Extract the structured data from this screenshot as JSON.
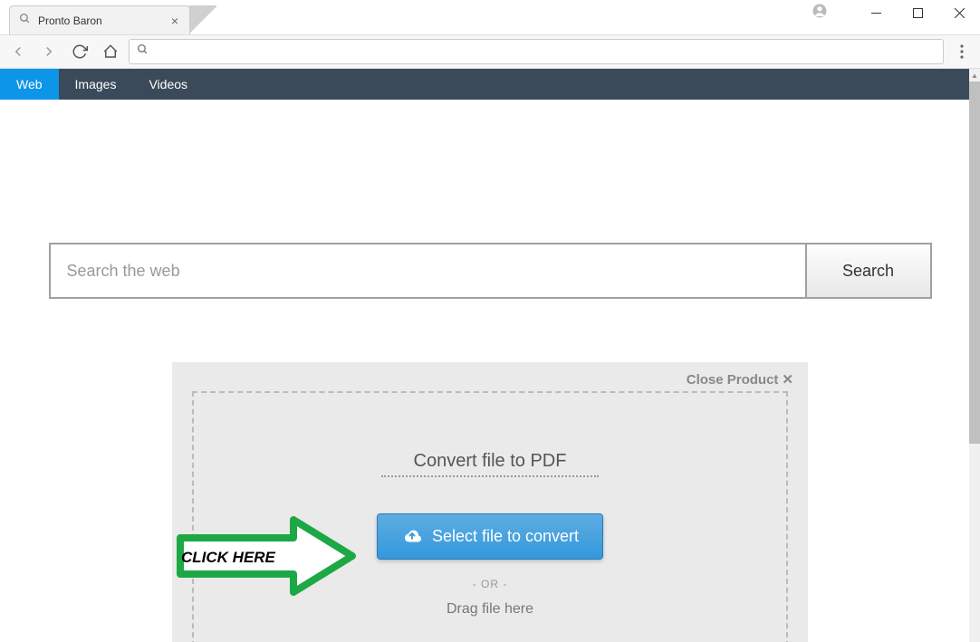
{
  "tab": {
    "title": "Pronto Baron"
  },
  "nav": {
    "tabs": [
      {
        "label": "Web",
        "active": true
      },
      {
        "label": "Images",
        "active": false
      },
      {
        "label": "Videos",
        "active": false
      }
    ]
  },
  "search": {
    "placeholder": "Search the web",
    "button": "Search"
  },
  "product": {
    "close_label": "Close Product",
    "title": "Convert file to PDF",
    "select_btn": "Select file to convert",
    "or": "- OR -",
    "drag": "Drag file here"
  },
  "annotation": {
    "click_here": "CLICK HERE"
  }
}
